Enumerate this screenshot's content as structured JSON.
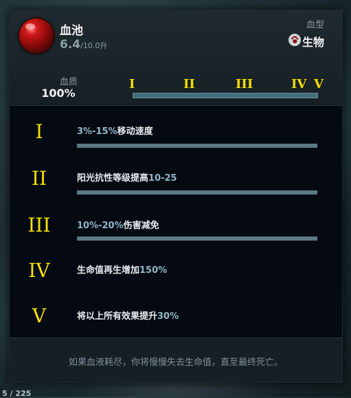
{
  "item": {
    "name": "血池",
    "volume_current": "6.4",
    "volume_max": "/10.0升"
  },
  "blood_type": {
    "label": "血型",
    "value": "生物",
    "icon": "paw-icon"
  },
  "quality": {
    "label": "血质",
    "value": "100%",
    "fill": 1.0
  },
  "tiers": [
    "I",
    "II",
    "III",
    "IV",
    "V"
  ],
  "effects": [
    {
      "numeral": "I",
      "highlight": "3%-15%",
      "text": "移动速度",
      "order": "hl-first",
      "has_bar": true
    },
    {
      "numeral": "II",
      "text": "阳光抗性等级提高",
      "highlight": "10-25",
      "order": "text-first",
      "has_bar": true
    },
    {
      "numeral": "III",
      "highlight": "10%-20%",
      "text": "伤害减免",
      "order": "hl-first",
      "has_bar": true
    },
    {
      "numeral": "IV",
      "text": "生命值再生增加",
      "highlight": "150%",
      "order": "text-first",
      "has_bar": false
    },
    {
      "numeral": "V",
      "text": "将以上所有效果提升",
      "highlight": "30%",
      "order": "text-first",
      "has_bar": false
    }
  ],
  "footer": "如果血液耗尽，你将慢慢失去生命值，直至最终死亡。",
  "corner_text": "5 / 225",
  "colors": {
    "accent_yellow": "#f5e000",
    "highlight_blue": "#8fb8c6",
    "orb_red": "#c21414"
  }
}
